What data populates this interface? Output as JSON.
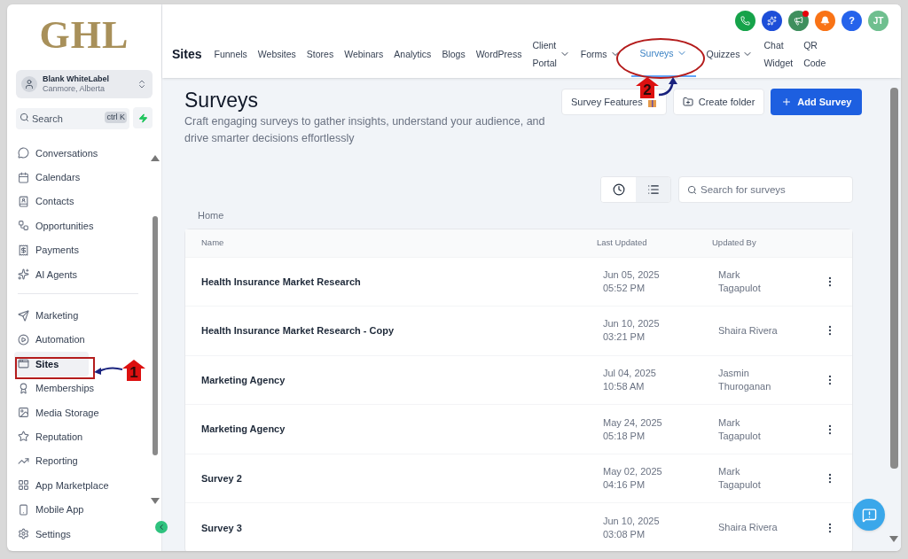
{
  "sidebar": {
    "logo": "GHL",
    "account": {
      "name": "Blank WhiteLabel",
      "location": "Canmore, Alberta"
    },
    "search": {
      "placeholder": "Search",
      "shortcut": "ctrl K"
    },
    "groups": [
      [
        {
          "label": "Conversations",
          "selected": false
        },
        {
          "label": "Calendars",
          "selected": false
        },
        {
          "label": "Contacts",
          "selected": false
        },
        {
          "label": "Opportunities",
          "selected": false
        },
        {
          "label": "Payments",
          "selected": false
        },
        {
          "label": "AI Agents",
          "selected": false
        }
      ],
      [
        {
          "label": "Marketing",
          "selected": false
        },
        {
          "label": "Automation",
          "selected": false
        },
        {
          "label": "Sites",
          "selected": true
        },
        {
          "label": "Memberships",
          "selected": false
        },
        {
          "label": "Media Storage",
          "selected": false
        },
        {
          "label": "Reputation",
          "selected": false
        },
        {
          "label": "Reporting",
          "selected": false
        },
        {
          "label": "App Marketplace",
          "selected": false
        },
        {
          "label": "Mobile App",
          "selected": false
        },
        {
          "label": "Settings",
          "selected": false
        }
      ]
    ]
  },
  "header": {
    "section": "Sites",
    "tabs": [
      {
        "label": "Funnels",
        "dropdown": false,
        "selected": false
      },
      {
        "label": "Websites",
        "dropdown": false,
        "selected": false
      },
      {
        "label": "Stores",
        "dropdown": false,
        "selected": false
      },
      {
        "label": "Webinars",
        "dropdown": false,
        "selected": false
      },
      {
        "label": "Analytics",
        "dropdown": false,
        "selected": false
      },
      {
        "label": "Blogs",
        "dropdown": false,
        "selected": false
      },
      {
        "label": "WordPress",
        "dropdown": false,
        "selected": false
      },
      {
        "label": "Client Portal",
        "dropdown": true,
        "selected": false
      },
      {
        "label": "Forms",
        "dropdown": true,
        "selected": false
      },
      {
        "label": "Surveys",
        "dropdown": true,
        "selected": true
      },
      {
        "label": "Quizzes",
        "dropdown": true,
        "selected": false
      },
      {
        "label": "Chat Widget",
        "dropdown": false,
        "selected": false
      },
      {
        "label": "QR Code",
        "dropdown": false,
        "selected": false
      }
    ],
    "help": "?",
    "avatar": "JT"
  },
  "page": {
    "title": "Surveys",
    "subtitle": "Craft engaging surveys to gather insights, understand your audience, and drive smarter decisions effortlessly",
    "buttons": [
      {
        "label": "Survey Features",
        "kind": "features"
      },
      {
        "label": "Create folder",
        "kind": "folder"
      },
      {
        "label": "Add Survey",
        "kind": "primary"
      }
    ],
    "view_toggle": [
      {
        "kind": "recent",
        "selected": false
      },
      {
        "kind": "list",
        "selected": true
      }
    ],
    "search": {
      "placeholder": "Search for surveys"
    },
    "breadcrumb": "Home"
  },
  "table": {
    "columns": [
      "Name",
      "Last Updated",
      "Updated By"
    ],
    "rows": [
      {
        "name": "Health Insurance Market Research",
        "last_updated": [
          "Jun 05, 2025",
          "05:52 PM"
        ],
        "updated_by": [
          "Mark",
          "Tagapulot"
        ]
      },
      {
        "name": "Health Insurance Market Research - Copy",
        "last_updated": [
          "Jun 10, 2025",
          "03:21 PM"
        ],
        "updated_by": [
          "Shaira Rivera"
        ]
      },
      {
        "name": "Marketing Agency",
        "last_updated": [
          "Jul 04, 2025",
          "10:58 AM"
        ],
        "updated_by": [
          "Jasmin",
          "Thuroganan"
        ]
      },
      {
        "name": "Marketing Agency",
        "last_updated": [
          "May 24, 2025",
          "05:18 PM"
        ],
        "updated_by": [
          "Mark",
          "Tagapulot"
        ]
      },
      {
        "name": "Survey 2",
        "last_updated": [
          "May 02, 2025",
          "04:16 PM"
        ],
        "updated_by": [
          "Mark",
          "Tagapulot"
        ]
      },
      {
        "name": "Survey 3",
        "last_updated": [
          "Jun 10, 2025",
          "03:08 PM"
        ],
        "updated_by": [
          "Shaira Rivera"
        ]
      }
    ]
  },
  "annotations": [
    {
      "label": "1"
    },
    {
      "label": "2"
    }
  ]
}
